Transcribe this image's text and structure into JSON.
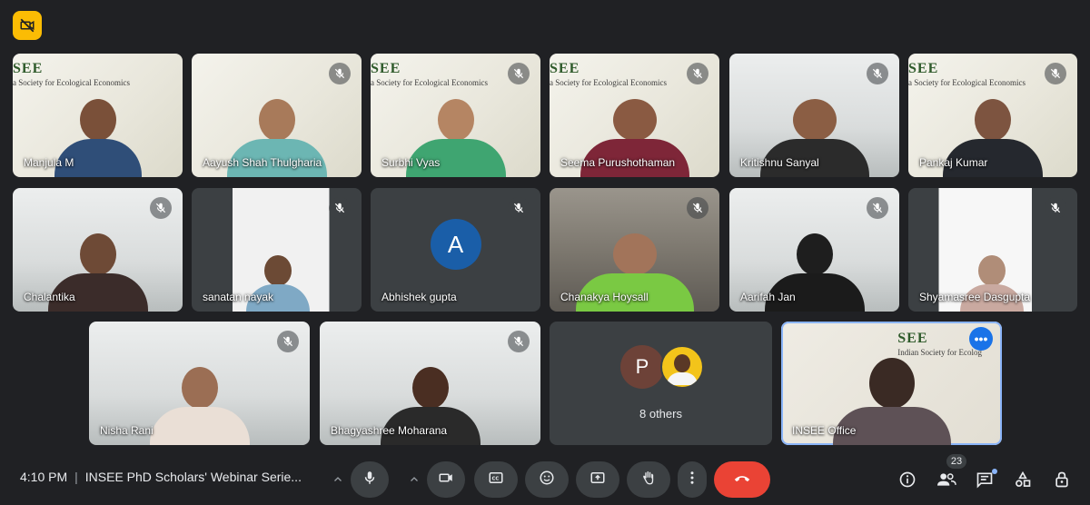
{
  "tiles": [
    {
      "name": "Manjula M",
      "muted": false
    },
    {
      "name": "Aayush Shah Thulgharia",
      "muted": true
    },
    {
      "name": "Surbhi Vyas",
      "muted": true
    },
    {
      "name": "Seema Purushothaman",
      "muted": true
    },
    {
      "name": "Kritishnu Sanyal",
      "muted": true
    },
    {
      "name": "Pankaj Kumar",
      "muted": true
    },
    {
      "name": "Chalantika",
      "muted": true
    },
    {
      "name": "sanatan nayak",
      "muted": true
    },
    {
      "name": "Abhishek gupta",
      "muted": true,
      "avatar_letter": "A"
    },
    {
      "name": "Chanakya Hoysall",
      "muted": true
    },
    {
      "name": "Aarifah Jan",
      "muted": true
    },
    {
      "name": "Shyamasree Dasgupta",
      "muted": true
    },
    {
      "name": "Nisha Rani",
      "muted": true
    },
    {
      "name": "Bhagyashree Moharana",
      "muted": true
    },
    {
      "name": "INSEE Office",
      "muted": false
    }
  ],
  "slide_text": {
    "big": "SEE",
    "small": "a Society for Ecological Economics"
  },
  "office_slide_text": {
    "big": "SEE",
    "small": "Indian Society for Ecolog"
  },
  "others": {
    "label": "8 others",
    "avatar_letter": "P"
  },
  "meeting": {
    "time": "4:10 PM",
    "separator": "|",
    "title": "INSEE PhD Scholars' Webinar Serie..."
  },
  "participants_count": "23",
  "colors": {
    "accent": "#8ab4f8",
    "end_call": "#ea4335",
    "badge": "#fbbc04",
    "avatar_a": "#1a5ea8"
  }
}
